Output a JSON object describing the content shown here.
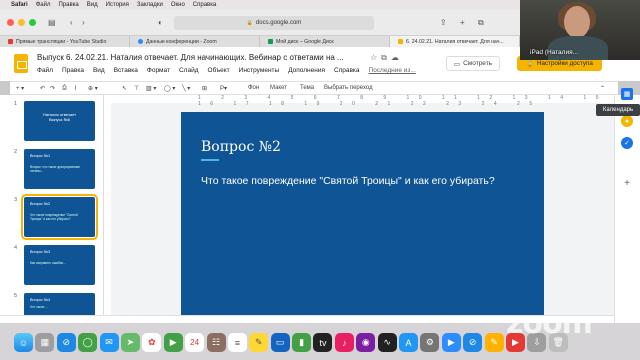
{
  "menubar": {
    "app": "Safari",
    "items": [
      "Файл",
      "Правка",
      "Вид",
      "История",
      "Закладки",
      "Окно",
      "Справка"
    ]
  },
  "browser": {
    "url": "docs.google.com",
    "tabs": [
      {
        "label": "Прямые трансляции - YouTube Studio",
        "color": "#e53935"
      },
      {
        "label": "Данные конференции - Zoom",
        "color": "#2d8cff"
      },
      {
        "label": "Мой диск – Google Диск",
        "color": "#0f9d58"
      },
      {
        "label": "6. 24.02.21. Наталия отвечает. Для нач...",
        "color": "#f4b400"
      }
    ]
  },
  "slides": {
    "doc_title": "Выпуск 6. 24.02.21. Наталия отвечает. Для начинающих. Вебинар с ответами на ...",
    "menu": [
      "Файл",
      "Правка",
      "Вид",
      "Вставка",
      "Формат",
      "Слайд",
      "Объект",
      "Инструменты",
      "Дополнения",
      "Справка"
    ],
    "last_edit": "Последние из...",
    "watch_label": "Смотреть",
    "share_label": "Настройки доступа",
    "toolbar": {
      "bg": "Фон",
      "layout": "Макет",
      "theme": "Тема",
      "transition": "Выбрать переход"
    },
    "ruler_ticks": "1 2 3 4 5 6 7 8 9 10 11 12 13 14 15 16 17 18 19 20 21 22 23 24 25"
  },
  "filmstrip": [
    {
      "num": "1",
      "title": "Наталия отвечает\nВыпуск №6",
      "body": ""
    },
    {
      "num": "2",
      "title": "Вопрос №1",
      "body": "Вопрос: что такое декорирование патины..."
    },
    {
      "num": "3",
      "title": "Вопрос №2",
      "body": "Что такое повреждение \"Святой Троицы\" и как его убирать?"
    },
    {
      "num": "4",
      "title": "Вопрос №3",
      "body": "Как исправить ошибки..."
    },
    {
      "num": "5",
      "title": "Вопрос №4",
      "body": "Что такое ..."
    }
  ],
  "slide": {
    "title": "Вопрос №2",
    "body": "Что такое повреждение \"Святой Троицы\" и как его убирать?"
  },
  "side_panel": {
    "tooltip": "Календарь"
  },
  "webcam": {
    "name": "iPad (Наталия..."
  },
  "dock": {
    "calendar_day": "24"
  },
  "zoom_watermark": "zoom"
}
